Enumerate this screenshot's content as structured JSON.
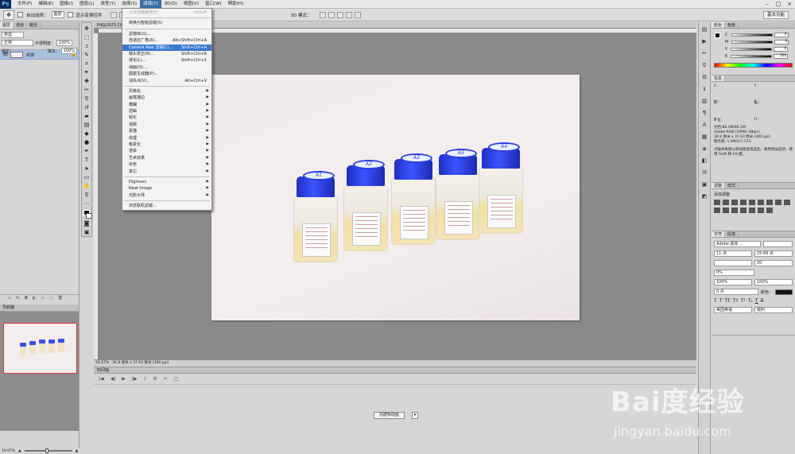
{
  "app": {
    "logo": "Ps"
  },
  "menu": [
    {
      "label": "文件(F)"
    },
    {
      "label": "编辑(E)"
    },
    {
      "label": "图像(I)"
    },
    {
      "label": "图层(L)"
    },
    {
      "label": "类型(Y)"
    },
    {
      "label": "选择(S)"
    },
    {
      "label": "滤镜(T)",
      "active": true
    },
    {
      "label": "3D(D)"
    },
    {
      "label": "视图(V)"
    },
    {
      "label": "窗口(W)"
    },
    {
      "label": "帮助(H)"
    }
  ],
  "options": {
    "auto_select_label": "自动选择：",
    "auto_select_value": "图层",
    "show_transform_label": "显示变换控件",
    "mode_label": "3D 模式："
  },
  "workspace": "基本功能",
  "layers_panel": {
    "tabs": [
      "图层",
      "通道",
      "路径"
    ],
    "kind_label": "类型",
    "blend_mode": "正常",
    "opacity_label": "不透明度：",
    "opacity_value": "100%",
    "lock_label": "锁定：",
    "fill_label": "填充：",
    "fill_value": "100%",
    "layer_name": "背景"
  },
  "navigator": {
    "title": "导航器",
    "zoom": "16.67%"
  },
  "document": {
    "tab_title": "XH@2825.CR",
    "status_zoom": "16.67%",
    "status_info": "36.8 厘米 x 37.93 厘米 (300 ppi)"
  },
  "filter_menu": [
    {
      "label": "上次滤镜操作(F)",
      "shortcut": "Ctrl+F",
      "disabled": true
    },
    {
      "sep": true
    },
    {
      "label": "转换为智能滤镜(S)"
    },
    {
      "sep": true
    },
    {
      "label": "滤镜库(G)..."
    },
    {
      "label": "自适应广角(A)...",
      "shortcut": "Alt+Shift+Ctrl+A"
    },
    {
      "label": "Camera Raw 滤镜(C)...",
      "shortcut": "Shift+Ctrl+A",
      "highlight": true
    },
    {
      "label": "镜头校正(R)...",
      "shortcut": "Shift+Ctrl+R"
    },
    {
      "label": "液化(L)...",
      "shortcut": "Shift+Ctrl+X"
    },
    {
      "label": "油画(O)..."
    },
    {
      "label": "图案生成器(P)..."
    },
    {
      "label": "消失点(V)...",
      "shortcut": "Alt+Ctrl+V"
    },
    {
      "sep": true
    },
    {
      "label": "风格化",
      "submenu": true
    },
    {
      "label": "画笔描边",
      "submenu": true
    },
    {
      "label": "模糊",
      "submenu": true
    },
    {
      "label": "扭曲",
      "submenu": true
    },
    {
      "label": "锐化",
      "submenu": true
    },
    {
      "label": "视频",
      "submenu": true
    },
    {
      "label": "素描",
      "submenu": true
    },
    {
      "label": "纹理",
      "submenu": true
    },
    {
      "label": "像素化",
      "submenu": true
    },
    {
      "label": "渲染",
      "submenu": true
    },
    {
      "label": "艺术效果",
      "submenu": true
    },
    {
      "label": "杂色",
      "submenu": true
    },
    {
      "label": "其它",
      "submenu": true
    },
    {
      "sep": true
    },
    {
      "label": "Digimarc",
      "submenu": true
    },
    {
      "label": "Neat Image",
      "submenu": true
    },
    {
      "label": "光影大师",
      "submenu": true
    },
    {
      "sep": true
    },
    {
      "label": "浏览联机滤镜..."
    }
  ],
  "bottles": [
    "A1",
    "A2",
    "A3",
    "A5",
    "A4"
  ],
  "timeline": {
    "title": "时间轴",
    "create_button": "创建帧动画"
  },
  "color_panel": {
    "tabs": [
      "颜色",
      "色板"
    ],
    "channels": [
      {
        "label": "C",
        "value": "0"
      },
      {
        "label": "M",
        "value": "0"
      },
      {
        "label": "Y",
        "value": "0"
      },
      {
        "label": "K",
        "value": "100"
      }
    ]
  },
  "info_panel": {
    "tabs": [
      "信息"
    ],
    "labels": [
      "C :",
      "M :",
      "Y :",
      "K :",
      "X :",
      "Y :",
      "W :",
      "H :"
    ],
    "bit_label": "8 位",
    "doc_lines": [
      "文档:86.1M/86.1M",
      "Adobe RGB (1998) (8bpc)",
      "36.8 厘米 x 37.93 厘米 (300 ppi)",
      "暂存盘: 1.0M/2/7.77G"
    ],
    "hint": "点按并拖移以移动图层或选区。要用附加选项，使用 Shift 和 Alt 键。"
  },
  "adjust_panel": {
    "tabs": [
      "调整",
      "样式"
    ],
    "title": "添加调整"
  },
  "char_panel": {
    "tabs": [
      "字符",
      "段落"
    ],
    "font": "Adobe 黑体 ...",
    "size": "11 点",
    "leading": "25.89 点",
    "tracking": "20",
    "scale": "0%",
    "vscale": "100%",
    "hscale": "100%",
    "baseline": "0 点",
    "color_label": "颜色：",
    "lang": "美国英语",
    "aa": "锐利"
  },
  "watermark": {
    "main": "Bai度经验",
    "sub": "jingyan.baidu.com"
  }
}
